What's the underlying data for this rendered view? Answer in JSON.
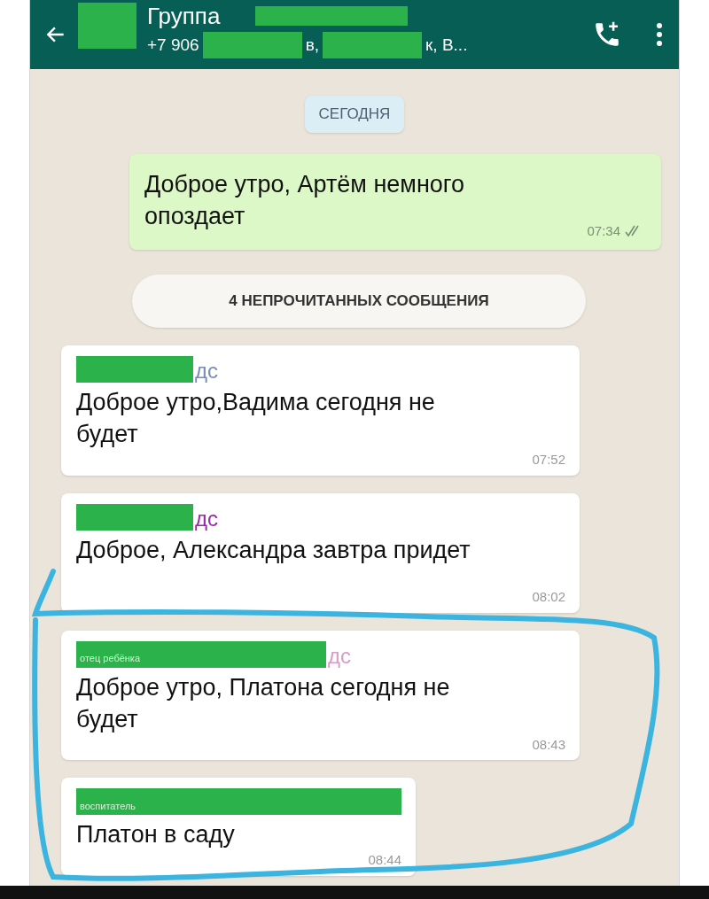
{
  "header": {
    "title": "Группа",
    "subtitle_parts": [
      {
        "kind": "text",
        "text": "+7 906"
      },
      {
        "kind": "redaction"
      },
      {
        "kind": "text",
        "text": "в,"
      },
      {
        "kind": "redaction"
      },
      {
        "kind": "text",
        "text": "к, В..."
      }
    ]
  },
  "date_chip": "СЕГОДНЯ",
  "outgoing": {
    "text": "Доброе утро, Артём немного опоздает",
    "time": "07:34",
    "read": true
  },
  "unread_banner": "4 НЕПРОЧИТАННЫХ СООБЩЕНИЯ",
  "messages": [
    {
      "sender_name": "дс",
      "color": "#7b8db5",
      "text": "Доброе утро,Вадима сегодня не будет",
      "time": "07:52"
    },
    {
      "sender_name": "дс",
      "color": "#9c27b0",
      "text": "Доброе, Александра завтра придет",
      "time": "08:02"
    },
    {
      "sender_label": "отец ребёнка",
      "sender_name": "дс",
      "color": "#d99ccb",
      "text": "Доброе утро, Платона сегодня не будет",
      "time": "08:43"
    },
    {
      "sender_label": "воспитатель",
      "text": "Платон в саду",
      "time": "08:44"
    }
  ]
}
